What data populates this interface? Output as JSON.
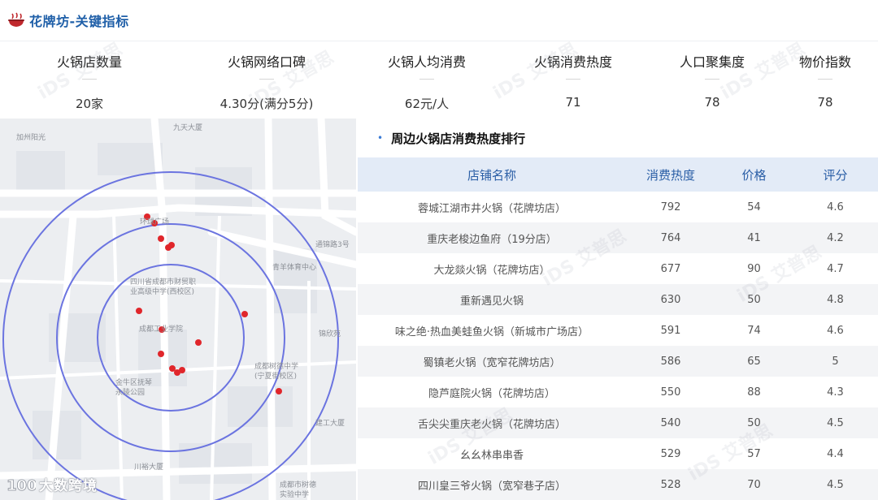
{
  "header": {
    "title": "花牌坊-关键指标",
    "icon": "hotpot-icon",
    "accent_color": "#1F5FA8"
  },
  "kpis": [
    {
      "label": "火锅店数量",
      "value": "20家"
    },
    {
      "label": "火锅网络口碑",
      "value": "4.30分(满分5分)"
    },
    {
      "label": "火锅人均消费",
      "value": "62元/人"
    },
    {
      "label": "火锅消费热度",
      "value": "71"
    },
    {
      "label": "人口聚集度",
      "value": "78"
    },
    {
      "label": "物价指数",
      "value": "78"
    }
  ],
  "map": {
    "ring_color": "#6B74E0",
    "marker_color": "#E0262B",
    "labels": {
      "jiazhou": "加州阳光",
      "jiutian": "九天大厦",
      "huanqiu": "环球广场",
      "tongjinlu": "通锦路3号",
      "qingyang": "青羊体育中心",
      "sichuan_school": "四川省成都市财贸职\n业高级中学(西校区)",
      "gongye": "成都工业学院",
      "jinxin": "锦欣苑",
      "shude": "成都树德中学\n(宁夏街校区)",
      "jinniu": "金牛区抚琴\n永陵公园",
      "jiangong": "建工大厦",
      "chuanyu": "川裕大厦",
      "shude_bottom": "成都市树德\n实验中学"
    }
  },
  "ranking": {
    "title": "周边火锅店消费热度排行",
    "columns": {
      "name": "店铺名称",
      "heat": "消费热度",
      "price": "价格",
      "score": "评分"
    },
    "rows": [
      {
        "name": "蓉城江湖市井火锅（花牌坊店）",
        "heat": "792",
        "price": "54",
        "score": "4.6"
      },
      {
        "name": "重庆老梭边鱼府（19分店）",
        "heat": "764",
        "price": "41",
        "score": "4.2"
      },
      {
        "name": "大龙燚火锅（花牌坊店）",
        "heat": "677",
        "price": "90",
        "score": "4.7"
      },
      {
        "name": "重新遇见火锅",
        "heat": "630",
        "price": "50",
        "score": "4.8"
      },
      {
        "name": "味之绝·热血美蛙鱼火锅（新城市广场店）",
        "heat": "591",
        "price": "74",
        "score": "4.6"
      },
      {
        "name": "蜀镇老火锅（宽窄花牌坊店）",
        "heat": "586",
        "price": "65",
        "score": "5"
      },
      {
        "name": "隐芦庭院火锅（花牌坊店）",
        "heat": "550",
        "price": "88",
        "score": "4.3"
      },
      {
        "name": "舌尖尖重庆老火锅（花牌坊店）",
        "heat": "540",
        "price": "50",
        "score": "4.5"
      },
      {
        "name": "幺幺林串串香",
        "heat": "529",
        "price": "57",
        "score": "4.4"
      },
      {
        "name": "四川皇三爷火锅（宽窄巷子店）",
        "heat": "528",
        "price": "70",
        "score": "4.5"
      }
    ]
  },
  "footer": {
    "brand": "大数跨境"
  },
  "watermark_text": "iDS 艾普思"
}
